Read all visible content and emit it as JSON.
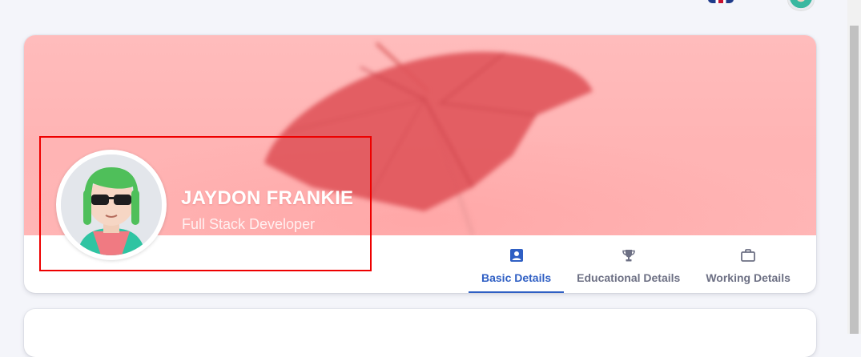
{
  "profile": {
    "name": "JAYDON FRANKIE",
    "role": "Full Stack Developer"
  },
  "tabs": [
    {
      "label": "Basic Details",
      "icon": "account-box-icon",
      "active": true
    },
    {
      "label": "Educational Details",
      "icon": "trophy-icon",
      "active": false
    },
    {
      "label": "Working Details",
      "icon": "briefcase-icon",
      "active": false
    }
  ],
  "colors": {
    "accent": "#2f5fc4",
    "banner": "#ffb4b4",
    "highlight": "#ee0000",
    "tab_text": "#6d7084"
  }
}
